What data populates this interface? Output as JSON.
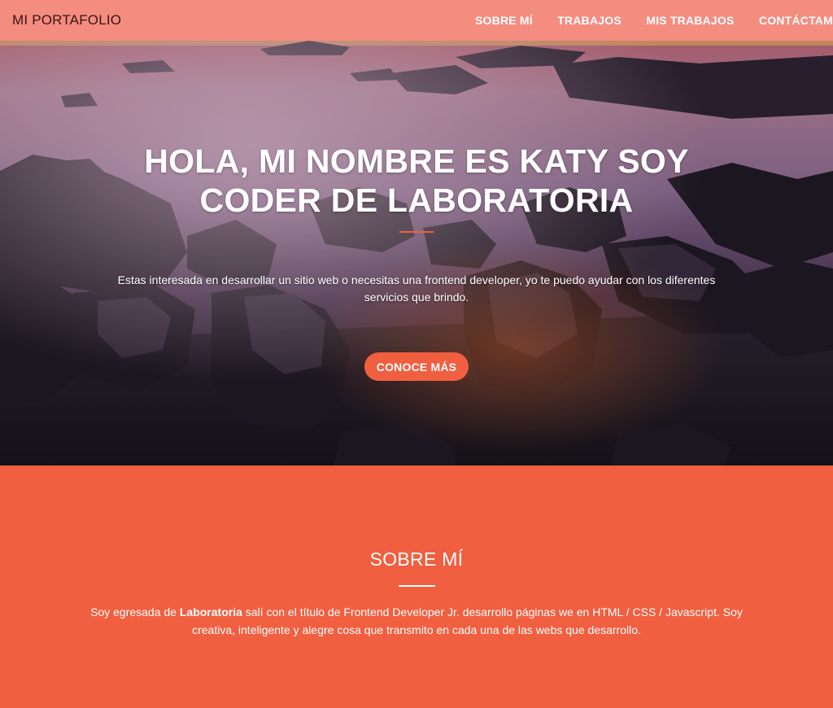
{
  "navbar": {
    "brand": "MI PORTAFOLIO",
    "links": [
      "SOBRE MÍ",
      "TRABAJOS",
      "MIS TRABAJOS",
      "CONTÁCTAME"
    ]
  },
  "hero": {
    "title_line1": "HOLA, MI NOMBRE ES KATY SOY",
    "title_line2": "CODER DE LABORATORIA",
    "description": "Estas interesada en desarrollar un sitio web o necesitas una frontend developer, yo te puedo ayudar con los diferentes servicios que brindo.",
    "button_label": "CONOCE MÁS",
    "background": "rocky-beach-sunset-photo"
  },
  "about": {
    "title": "SOBRE MÍ",
    "text_before": "Soy egresada de ",
    "text_bold": "Laboratoria",
    "text_after": " salí con el título de Frontend Developer Jr. desarrollo páginas we en HTML / CSS / Javascript. Soy creativa, inteligente y alegre cosa que transmito en cada una de las webs que desarrollo."
  },
  "colors": {
    "accent": "#f05f40",
    "navbar": "#f48c80",
    "text_light": "#ffffff"
  }
}
